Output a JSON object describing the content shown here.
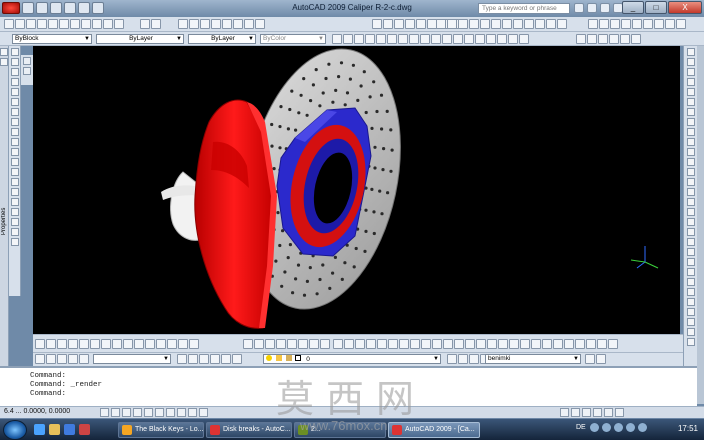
{
  "window": {
    "title": "AutoCAD 2009 Caliper R-2-c.dwg",
    "search_placeholder": "Type a keyword or phrase",
    "minimize": "_",
    "maximize": "□",
    "close": "X"
  },
  "toolbar": {
    "layer_select": "ByBlock",
    "linetype_select": "ByLayer",
    "lineweight_select": "ByLayer",
    "plotstyle_select": "ByColor"
  },
  "layers": {
    "current_layer": "0",
    "visual_style": "benimki"
  },
  "side": {
    "properties_label": "Properties"
  },
  "commandline": {
    "lines": [
      "Command:",
      "Command: _render",
      "Command:"
    ]
  },
  "status": {
    "coords": "6.4 ...  0.0000, 0.0000"
  },
  "taskbar": {
    "buttons": [
      {
        "label": "The Black Keys - Lo..."
      },
      {
        "label": "Disk breaks - AutoC..."
      },
      {
        "label": "2..."
      },
      {
        "label": "AutoCAD 2009 - [Ca..."
      }
    ],
    "lang": "DE",
    "clock": "17:51"
  },
  "watermark": {
    "text": "莫西网",
    "url": "www.76mox.cn"
  },
  "colors": {
    "caliper": "#e60000",
    "hub": "#2a28c9",
    "disc": "#c9c9c9",
    "background": "#000000"
  }
}
